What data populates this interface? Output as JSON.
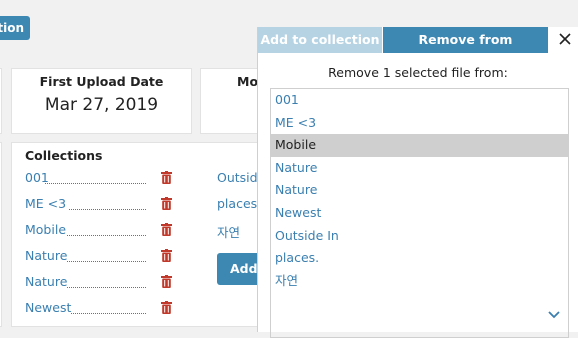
{
  "toolbar": {
    "collection_button_label": "ollection"
  },
  "cards": {
    "first_upload": {
      "label": "First Upload Date",
      "value": "Mar 27, 2019"
    },
    "partial_label": "Mo"
  },
  "collections": {
    "title": "Collections",
    "items": [
      {
        "label": "001"
      },
      {
        "label": "ME <3"
      },
      {
        "label": "Mobile"
      },
      {
        "label": "Nature"
      },
      {
        "label": "Nature"
      },
      {
        "label": "Newest"
      }
    ],
    "more_items": [
      "Outside",
      "places",
      "자연"
    ],
    "add_button_label": "Add"
  },
  "panel": {
    "tab_add_label": "Add to collection",
    "tab_remove_label": "Remove from collection",
    "message": "Remove 1 selected file from:",
    "options": [
      "001",
      "ME <3",
      "Mobile",
      "Nature",
      "Nature",
      "Newest",
      "Outside In",
      "places.",
      "자연"
    ],
    "selected_option": "Mobile"
  },
  "colors": {
    "accent": "#3d87b3",
    "link": "#3a7fb0",
    "trash": "#c0392b"
  }
}
